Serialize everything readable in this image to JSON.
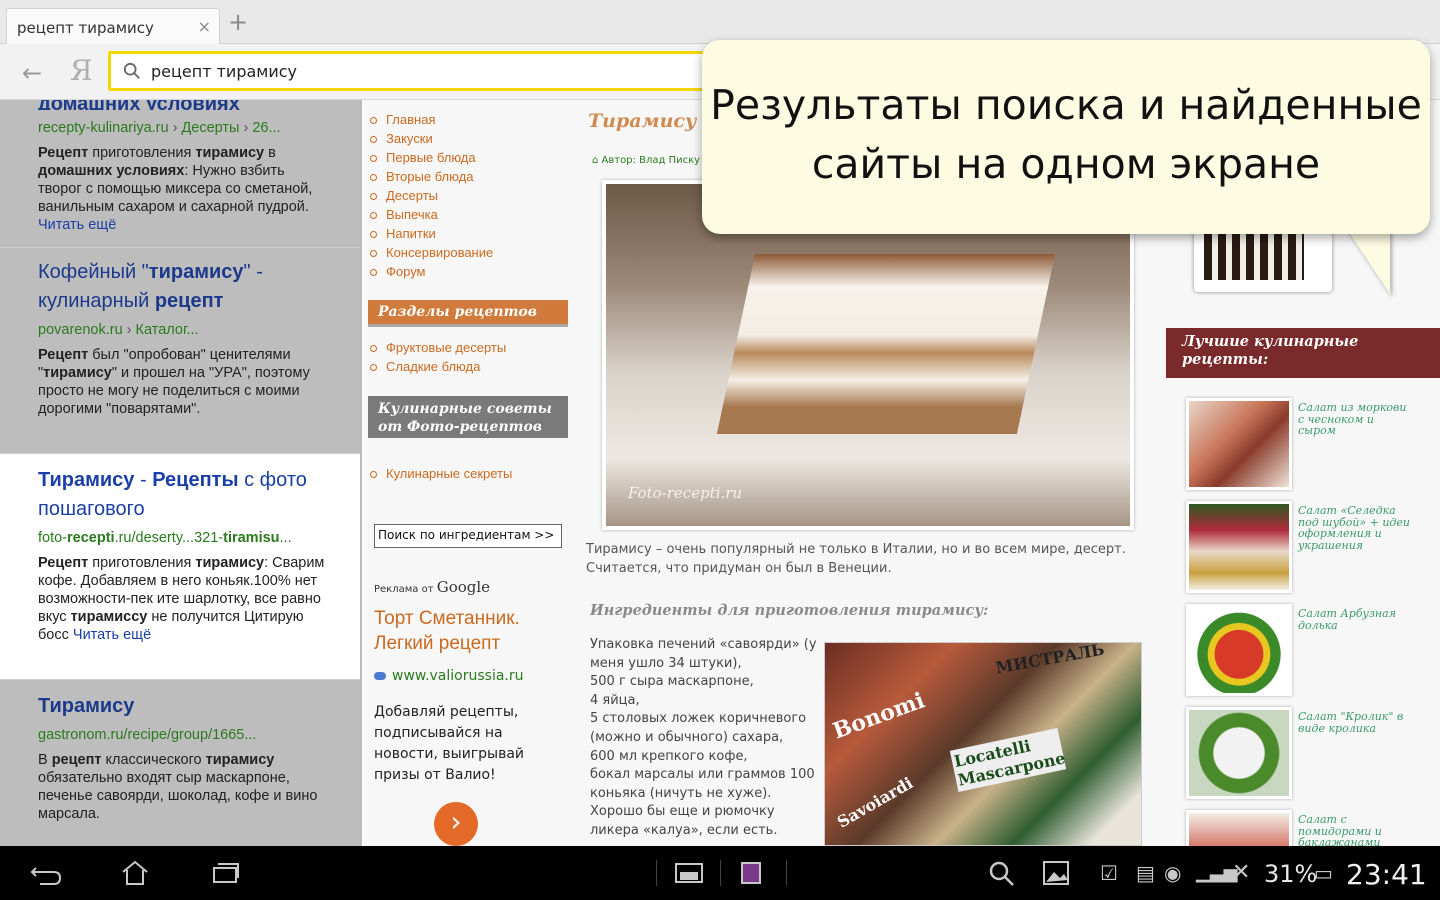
{
  "tab": {
    "title": "рецепт тирамису",
    "close": "×",
    "new_tab": "+"
  },
  "address": {
    "query": "рецепт тирамису",
    "back": "←",
    "logo": "Я"
  },
  "results": [
    {
      "title_tail": "домашних условиях",
      "url_host": "recepty-kulinariya.ru",
      "url_path1": "Десерты",
      "url_path2": "26...",
      "snippet_html": "<b>Рецепт</b> приготовления <b>тирамису</b> в <b>домашних условиях</b>: Нужно взбить творог с помощью миксера со сметаной, ванильным сахаром и сахарной пудрой.",
      "read_more": "Читать ещё"
    },
    {
      "title_html": "Кофейный \"<b>тирамису</b>\" - кулинарный <b>рецепт</b>",
      "url_host": "povarenok.ru",
      "url_path1": "Каталог...",
      "snippet_html": "<b>Рецепт</b> был \"опробован\" ценителями \"<b>тирамису</b>\" и прошел на \"УРА\", поэтому просто не могу не поделиться с моими дорогими \"поварятами\"."
    },
    {
      "title_html": "<b>Тирамису</b> - <b>Рецепты</b> с фото пошагового",
      "url_html": "foto-<b>recepti</b>.ru/deserty...321-<b>tiramisu</b>...",
      "snippet_html": "<b>Рецепт</b> приготовления <b>тирамису</b>: Сварим кофе. Добавляем в него коньяк.100% нет возможности-пек ите шарлотку, все равно вкус <b>тирамиссу</b> не получится Цитирую босс",
      "read_more": "Читать ещё"
    },
    {
      "title_html": "<b>Тирамису</b>",
      "url": "gastronom.ru/recipe/group/1665...",
      "snippet_html": "В <b>рецепт</b> классического <b>тирамису</b> обязательно входят сыр маскарпоне, печенье савоярди, шоколад, кофе и вино марсала."
    }
  ],
  "site": {
    "menu": [
      "Главная",
      "Закуски",
      "Первые блюда",
      "Вторые блюда",
      "Десерты",
      "Выпечка",
      "Напитки",
      "Консервирование",
      "Форум"
    ],
    "sections_head": "Разделы рецептов",
    "sections": [
      "Фруктовые десерты",
      "Сладкие блюда"
    ],
    "tips_head": "Кулинарные советы от Фото-рецептов",
    "tips": [
      "Кулинарные секреты"
    ],
    "ingredient_search": "Поиск по ингредиентам >>",
    "ads_label": "Реклама от",
    "ads_google": "Google",
    "ad_title": "Торт Сметанник. Легкий рецепт",
    "ad_url": "www.valiorussia.ru",
    "ad_text": "Добавляй рецепты, подписывайся на новости, выигрывай призы от Валио!",
    "ad_button": "›",
    "article_title": "Тирамису",
    "author": "Автор: Влад Писку",
    "photo_watermark": "Foto-recepti.ru",
    "description": "Тирамису – очень популярный не только в Италии, но и во всем мире, десерт. Считается, что придуман он был в Венеции.",
    "ingredients_head": "Ингредиенты для приготовления тирамису:",
    "ingredients": [
      "Упаковка печений «савоярди» (у меня ушло 34 штуки),",
      "500 г сыра маскарпоне,",
      "4 яйца,",
      "5 столовых ложек коричневого (можно и обычного) сахара,",
      "600 мл крепкого кофе,",
      "бокал марсалы или граммов 100 коньяка (ничуть не хуже).",
      "Хорошо бы еще и рюмочку ликера «калуа», если есть."
    ],
    "ingr_photo_labels": [
      "Bonomi",
      "Savoiardi",
      "Locatelli Mascarpone",
      "МИСТРАЛЬ"
    ],
    "best_head": "Лучшие кулинарные рецепты:",
    "best": [
      "Салат из моркови с чесноком и сыром",
      "Салат «Селедка под шубой» + идеи оформления и украшения",
      "Салат Арбузная долька",
      "Салат \"Кролик\" в виде кролика",
      "Салат с помидорами и баклажанами"
    ]
  },
  "callout": {
    "line1": "Результаты поиска и найденные",
    "line2": "сайты на одном экране"
  },
  "system": {
    "battery": "31%",
    "clock": "23:41"
  },
  "colors": {
    "accent_yellow": "#f4d800",
    "link_blue": "#1b3fa8",
    "url_green": "#2b7a1e",
    "site_orange": "#c96a20",
    "best_head_red": "#7a2a2a"
  }
}
